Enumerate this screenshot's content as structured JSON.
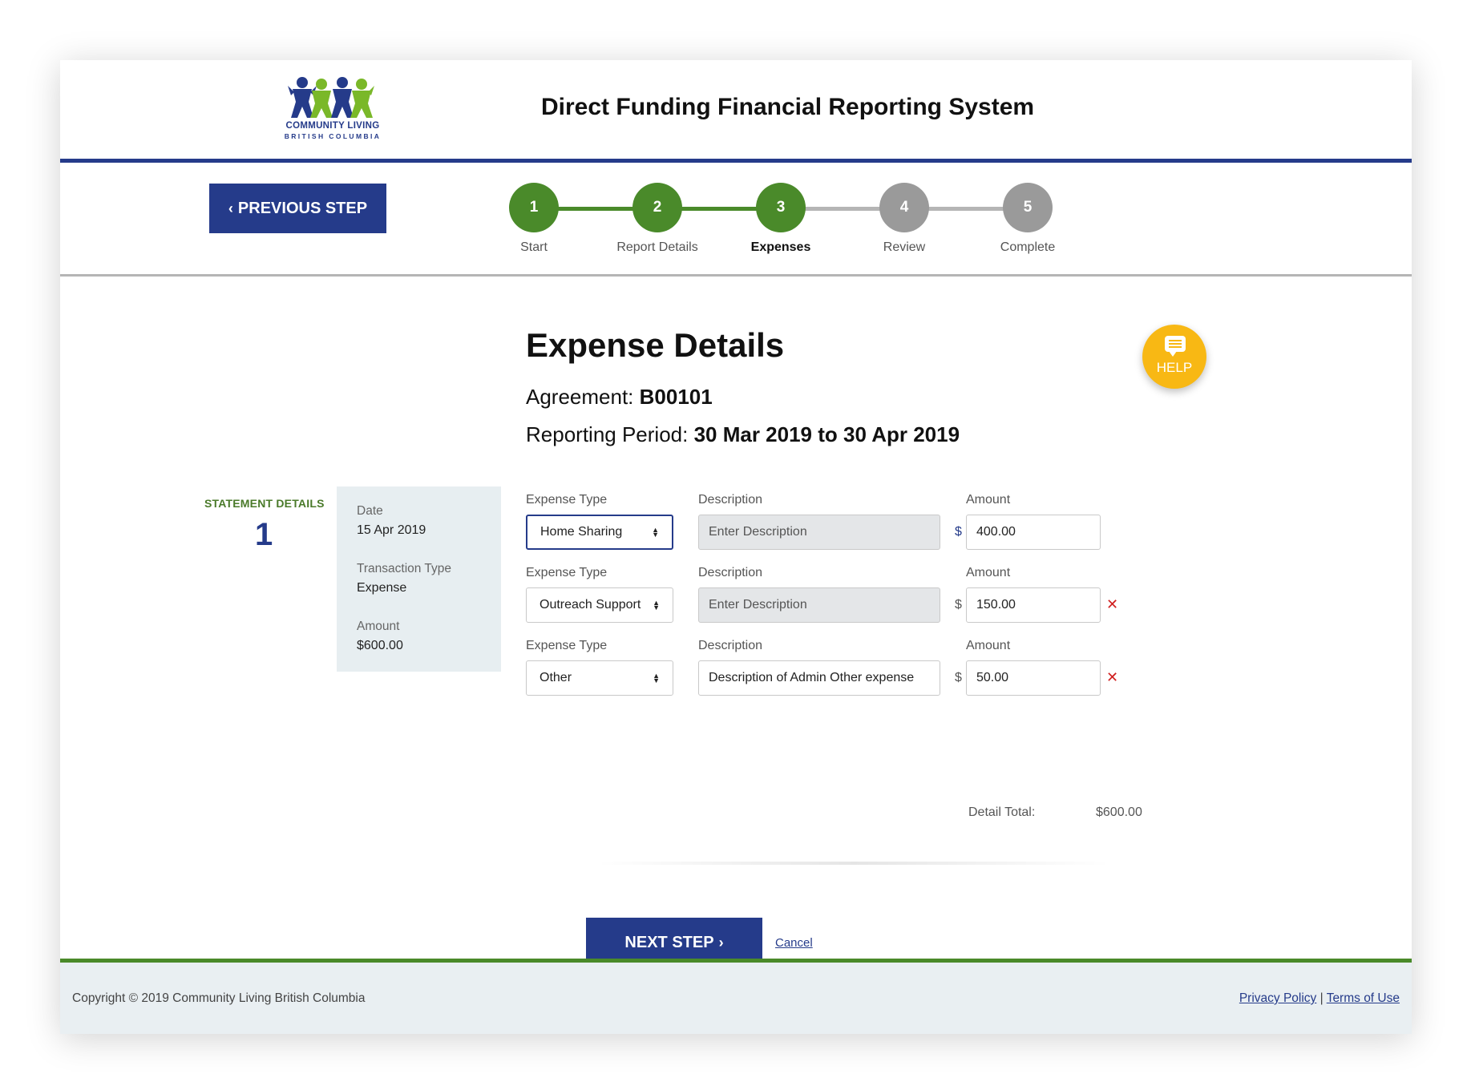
{
  "header": {
    "logo_line1": "COMMUNITY LIVING",
    "logo_line2": "BRITISH COLUMBIA",
    "title": "Direct Funding Financial Reporting System"
  },
  "nav": {
    "previous_label": "PREVIOUS STEP",
    "steps": [
      {
        "num": "1",
        "label": "Start",
        "state": "done"
      },
      {
        "num": "2",
        "label": "Report Details",
        "state": "done"
      },
      {
        "num": "3",
        "label": "Expenses",
        "state": "active"
      },
      {
        "num": "4",
        "label": "Review",
        "state": "pending"
      },
      {
        "num": "5",
        "label": "Complete",
        "state": "pending"
      }
    ]
  },
  "help": {
    "label": "HELP",
    "icon": "chat-bubble-icon"
  },
  "page": {
    "title": "Expense Details",
    "agreement_label": "Agreement:",
    "agreement_value": "B00101",
    "period_label": "Reporting Period:",
    "period_value": "30 Mar 2019 to 30 Apr 2019"
  },
  "statement": {
    "label": "STATEMENT DETAILS",
    "number": "1",
    "date_label": "Date",
    "date_value": "15 Apr 2019",
    "type_label": "Transaction Type",
    "type_value": "Expense",
    "amount_label": "Amount",
    "amount_value": "$600.00"
  },
  "expenses": {
    "type_label": "Expense Type",
    "desc_label": "Description",
    "amount_label": "Amount",
    "currency": "$",
    "rows": [
      {
        "type": "Home Sharing",
        "description": "",
        "description_placeholder": "Enter Description",
        "amount": "400.00"
      },
      {
        "type": "Outreach Support",
        "description": "",
        "description_placeholder": "Enter Description",
        "amount": "150.00"
      },
      {
        "type": "Other",
        "description": "Description of Admin Other expense",
        "description_placeholder": "",
        "amount": "50.00"
      }
    ]
  },
  "totals": {
    "label": "Detail Total:",
    "value": "$600.00"
  },
  "actions": {
    "next_label": "NEXT STEP",
    "cancel_label": "Cancel"
  },
  "footer": {
    "copyright": "Copyright © 2019 Community Living British Columbia",
    "privacy": "Privacy Policy",
    "separator": "|",
    "terms": "Terms of Use"
  },
  "colors": {
    "brand_blue": "#253b8a",
    "step_green": "#4a8a2a",
    "step_gray": "#9a9a9a",
    "help_yellow": "#f8b814",
    "delete_red": "#d02020"
  }
}
